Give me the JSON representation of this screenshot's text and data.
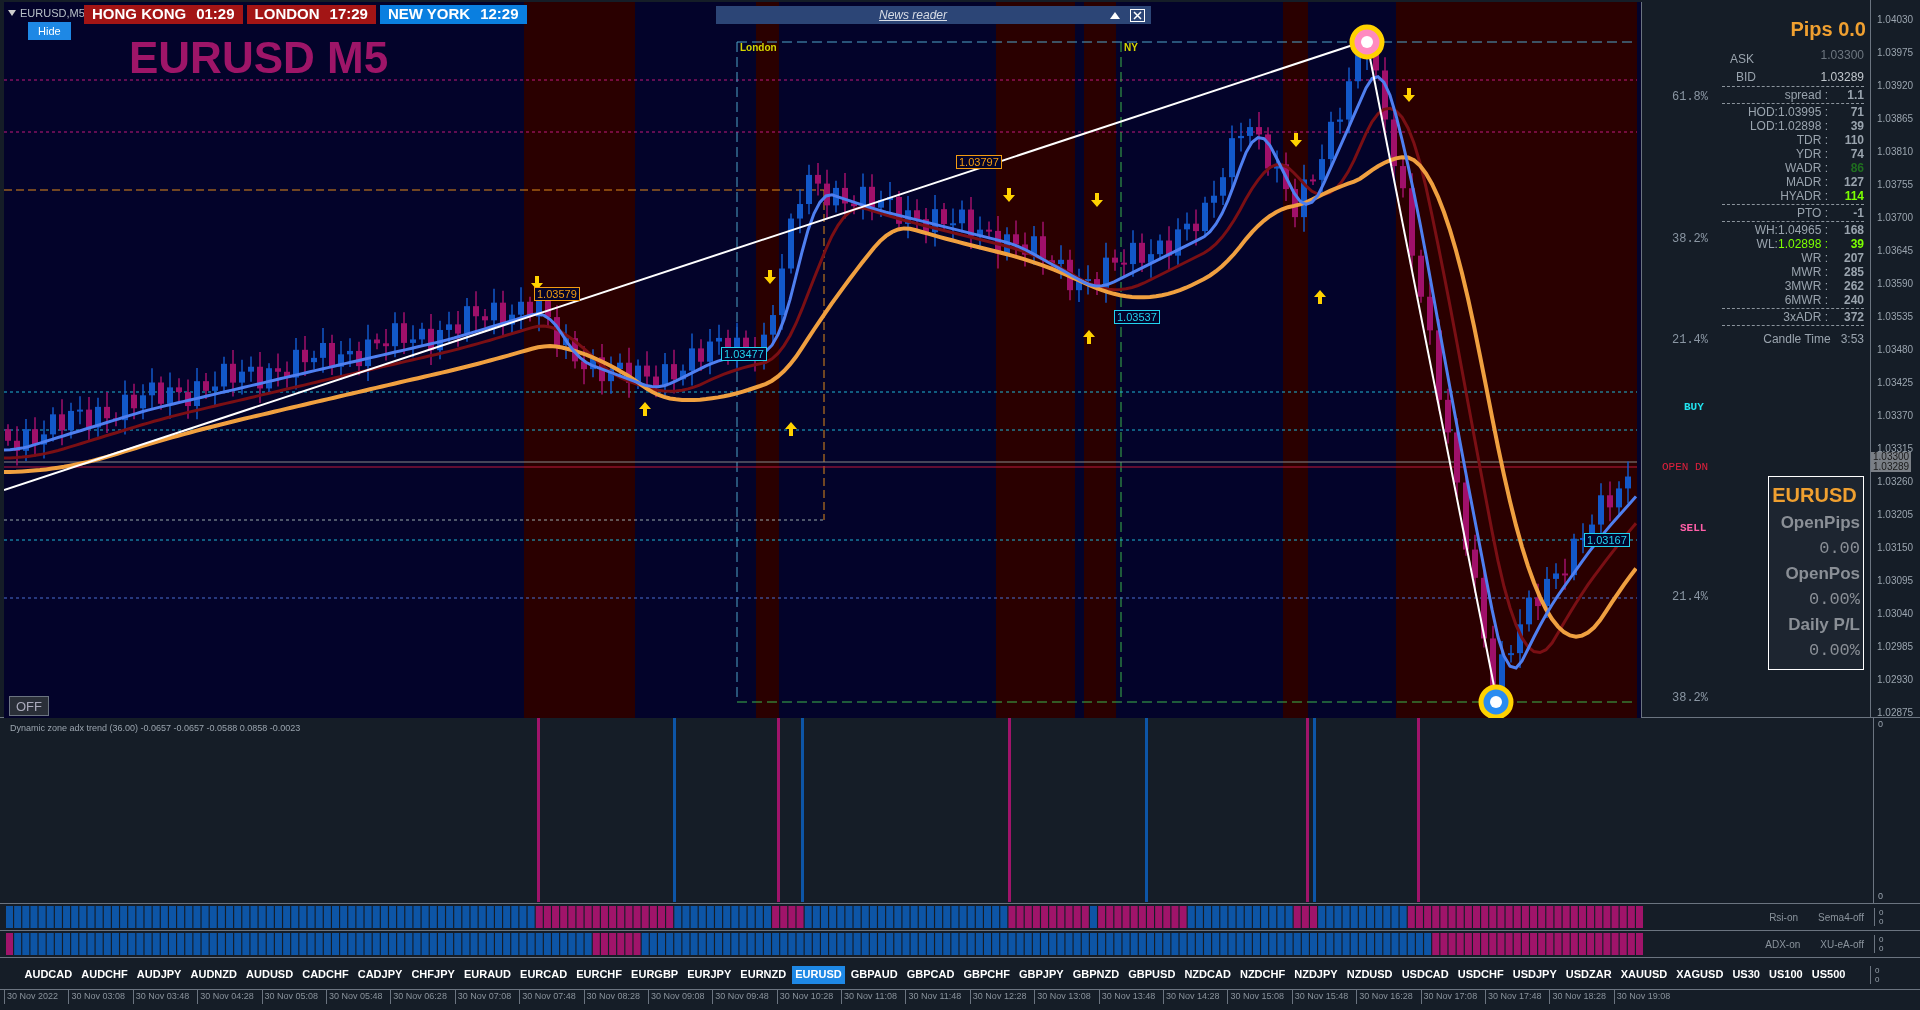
{
  "window": {
    "title": "EURUSD,M5"
  },
  "hide_button": "Hide",
  "clocks": [
    {
      "city": "HONG KONG",
      "time": "01:29",
      "color": "#a31515"
    },
    {
      "city": "LONDON",
      "time": "17:29",
      "color": "#a31515"
    },
    {
      "city": "NEW YORK",
      "time": "12:29",
      "color": "#0a7fe0"
    }
  ],
  "news_reader": {
    "title": "News reader"
  },
  "chart_title": "EURUSD M5",
  "session_labels": [
    "London",
    "NY"
  ],
  "price_tags": [
    {
      "text": "1.03579",
      "color": "#f39c12"
    },
    {
      "text": "1.03797",
      "color": "#f39c12"
    },
    {
      "text": "1.03477",
      "color": "#22d3ee"
    },
    {
      "text": "1.03537",
      "color": "#22d3ee"
    },
    {
      "text": "1.03167",
      "color": "#22d3ee"
    }
  ],
  "off_button": "OFF",
  "info": {
    "pips": "Pips 0.0",
    "ask_label": "ASK",
    "ask": "1.03300",
    "bid_label": "BID",
    "bid": "1.03289",
    "groups": [
      [
        {
          "label": "spread :",
          "value": "1.1"
        }
      ],
      [
        {
          "label": "HOD:",
          "price": "1.03995 :",
          "value": "71"
        },
        {
          "label": "LOD:",
          "price": "1.02898 :",
          "value": "39"
        },
        {
          "label": "TDR :",
          "value": "110"
        },
        {
          "label": "YDR :",
          "value": "74"
        },
        {
          "label": "WADR :",
          "value": "86",
          "color": "#1f6e1f"
        },
        {
          "label": "MADR :",
          "value": "127"
        },
        {
          "label": "HYADR :",
          "value": "114",
          "color": "#7cff00"
        }
      ],
      [
        {
          "label": "PTO :",
          "value": "-1"
        }
      ],
      [
        {
          "label": "WH:",
          "price": "1.04965 :",
          "value": "168"
        },
        {
          "label": "WL:",
          "price": "1.02898 :",
          "value": "39",
          "color": "#7cff00"
        },
        {
          "label": "WR :",
          "value": "207"
        },
        {
          "label": "MWR :",
          "value": "285"
        },
        {
          "label": "3MWR :",
          "value": "262"
        },
        {
          "label": "6MWR :",
          "value": "240"
        }
      ],
      [
        {
          "label": "3xADR :",
          "value": "372"
        }
      ]
    ],
    "candle_time_label": "Candle Time",
    "candle_time": "3:53"
  },
  "chart_labels": [
    {
      "text": "61.8%",
      "kind": "fib"
    },
    {
      "text": "38.2%",
      "kind": "fib"
    },
    {
      "text": "21.4%",
      "kind": "fib"
    },
    {
      "text": "BUY",
      "kind": "buy"
    },
    {
      "text": "OPEN DN",
      "kind": "open"
    },
    {
      "text": "SELL",
      "kind": "sell"
    },
    {
      "text": "21.4%",
      "kind": "fib"
    },
    {
      "text": "38.2%",
      "kind": "fib"
    }
  ],
  "position_box": {
    "symbol": "EURUSD",
    "rows": [
      {
        "label": "OpenPips",
        "value": "0.00"
      },
      {
        "label": "OpenPos",
        "value": "0.00%"
      },
      {
        "label": "Daily P/L",
        "value": "0.00%"
      }
    ]
  },
  "price_axis": [
    "1.04030",
    "1.03975",
    "1.03920",
    "1.03865",
    "1.03810",
    "1.03755",
    "1.03700",
    "1.03645",
    "1.03590",
    "1.03535",
    "1.03480",
    "1.03425",
    "1.03370",
    "1.03315",
    "1.03260",
    "1.03205",
    "1.03150",
    "1.03095",
    "1.03040",
    "1.02985",
    "1.02930",
    "1.02875"
  ],
  "current_prices": [
    "1.03300",
    "1.03289"
  ],
  "indicator": {
    "title": "Dynamic zone adx trend (36.00) -0.0657 -0.0657 -0.0588 0.0858 -0.0023",
    "axis": [
      "0",
      "0"
    ]
  },
  "strips": [
    {
      "labels": [
        "Rsi-on",
        "Sema4-off"
      ],
      "axis": [
        "0",
        "0"
      ]
    },
    {
      "labels": [
        "ADX-on",
        "XU-eA-off"
      ],
      "axis": [
        "0",
        "0"
      ]
    }
  ],
  "symbols": [
    {
      "name": "AUDCAD",
      "selected": false
    },
    {
      "name": "AUDCHF",
      "selected": false
    },
    {
      "name": "AUDJPY",
      "selected": false
    },
    {
      "name": "AUDNZD",
      "selected": false
    },
    {
      "name": "AUDUSD",
      "selected": false
    },
    {
      "name": "CADCHF",
      "selected": false
    },
    {
      "name": "CADJPY",
      "selected": false
    },
    {
      "name": "CHFJPY",
      "selected": false
    },
    {
      "name": "EURAUD",
      "selected": false
    },
    {
      "name": "EURCAD",
      "selected": false
    },
    {
      "name": "EURCHF",
      "selected": false
    },
    {
      "name": "EURGBP",
      "selected": false
    },
    {
      "name": "EURJPY",
      "selected": false
    },
    {
      "name": "EURNZD",
      "selected": false
    },
    {
      "name": "EURUSD",
      "selected": true
    },
    {
      "name": "GBPAUD",
      "selected": false
    },
    {
      "name": "GBPCAD",
      "selected": false
    },
    {
      "name": "GBPCHF",
      "selected": false
    },
    {
      "name": "GBPJPY",
      "selected": false
    },
    {
      "name": "GBPNZD",
      "selected": false
    },
    {
      "name": "GBPUSD",
      "selected": false
    },
    {
      "name": "NZDCAD",
      "selected": false
    },
    {
      "name": "NZDCHF",
      "selected": false
    },
    {
      "name": "NZDJPY",
      "selected": false
    },
    {
      "name": "NZDUSD",
      "selected": false
    },
    {
      "name": "USDCAD",
      "selected": false
    },
    {
      "name": "USDCHF",
      "selected": false
    },
    {
      "name": "USDJPY",
      "selected": false
    },
    {
      "name": "USDZAR",
      "selected": false
    },
    {
      "name": "XAUUSD",
      "selected": false
    },
    {
      "name": "XAGUSD",
      "selected": false
    },
    {
      "name": "US30",
      "selected": false
    },
    {
      "name": "US100",
      "selected": false
    },
    {
      "name": "US500",
      "selected": false
    }
  ],
  "symbols_axis": [
    "0",
    "0"
  ],
  "time_axis": [
    "30 Nov 2022",
    "30 Nov 03:08",
    "30 Nov 03:48",
    "30 Nov 04:28",
    "30 Nov 05:08",
    "30 Nov 05:48",
    "30 Nov 06:28",
    "30 Nov 07:08",
    "30 Nov 07:48",
    "30 Nov 08:28",
    "30 Nov 09:08",
    "30 Nov 09:48",
    "30 Nov 10:28",
    "30 Nov 11:08",
    "30 Nov 11:48",
    "30 Nov 12:28",
    "30 Nov 13:08",
    "30 Nov 13:48",
    "30 Nov 14:28",
    "30 Nov 15:08",
    "30 Nov 15:48",
    "30 Nov 16:28",
    "30 Nov 17:08",
    "30 Nov 17:48",
    "30 Nov 18:28",
    "30 Nov 19:08"
  ]
}
